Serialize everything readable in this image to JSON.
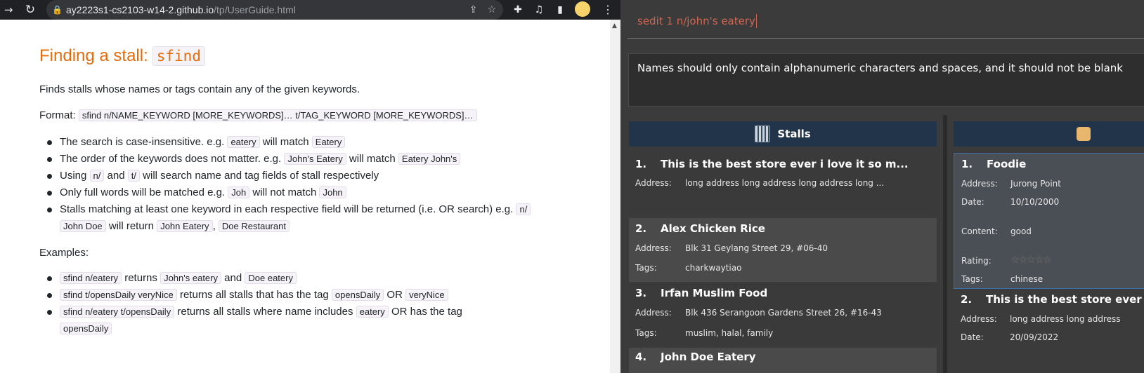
{
  "browser": {
    "url_host": "ay2223s1-cs2103-w14-2.github.io",
    "url_path": "/tp/UserGuide.html",
    "nav_icons": [
      "forward-arrow-icon",
      "reload-icon"
    ],
    "url_icons": [
      "share-icon",
      "star-icon"
    ],
    "toolbar_icons": [
      "extensions-icon",
      "media-control-icon",
      "sidebar-icon",
      "profile-avatar-icon",
      "menu-icon"
    ]
  },
  "guide": {
    "heading_text": "Finding a stall:",
    "heading_code": "sfind",
    "description": "Finds stalls whose names or tags contain any of the given keywords.",
    "format_label": "Format:",
    "format_code": "sfind n/NAME_KEYWORD [MORE_KEYWORDS]… t/TAG_KEYWORD [MORE_KEYWORDS]…",
    "bullets": {
      "b1": {
        "t1": "The search is case-insensitive. e.g.",
        "c1": "eatery",
        "t2": "will match",
        "c2": "Eatery"
      },
      "b2": {
        "t1": "The order of the keywords does not matter. e.g.",
        "c1": "John's Eatery",
        "t2": "will match",
        "c2": "Eatery John's"
      },
      "b3": {
        "t1": "Using",
        "c1": "n/",
        "t2": "and",
        "c2": "t/",
        "t3": "will search name and tag fields of stall respectively"
      },
      "b4": {
        "t1": "Only full words will be matched e.g.",
        "c1": "Joh",
        "t2": "will not match",
        "c2": "John"
      },
      "b5": {
        "t1": "Stalls matching at least one keyword in each respective field will be returned (i.e. OR search) e.g.",
        "c1": "n/",
        "c2": "John Doe",
        "t2": "will return",
        "c3": "John Eatery",
        "t3": ",",
        "c4": "Doe Restaurant"
      }
    },
    "examples_label": "Examples:",
    "examples": {
      "e1": {
        "c1": "sfind n/eatery",
        "t1": "returns",
        "c2": "John's eatery",
        "t2": "and",
        "c3": "Doe eatery"
      },
      "e2": {
        "c1": "sfind t/opensDaily veryNice",
        "t1": "returns all stalls that has the tag",
        "c2": "opensDaily",
        "t2": "OR",
        "c3": "veryNice"
      },
      "e3": {
        "c1": "sfind n/eatery t/opensDaily",
        "t1": "returns all stalls where name includes",
        "c2": "eatery",
        "t2": "OR has the tag",
        "c3": "opensDaily"
      }
    }
  },
  "app": {
    "command_input": "sedit 1 n/john's eatery",
    "result_text": "Names should only contain alphanumeric characters and spaces, and it should not be blank",
    "stalls_title": "Stalls",
    "stalls": [
      {
        "index": "1.",
        "name": "This is the best store ever i love it so m...",
        "address_label": "Address:",
        "address": "long address long address long address long ..."
      },
      {
        "index": "2.",
        "name": "Alex Chicken Rice",
        "address_label": "Address:",
        "address": "Blk 31 Geylang Street 29, #06-40",
        "tags_label": "Tags:",
        "tags": "charkwaytiao"
      },
      {
        "index": "3.",
        "name": "Irfan Muslim Food",
        "address_label": "Address:",
        "address": "Blk 436 Serangoon Gardens Street 26, #16-43",
        "tags_label": "Tags:",
        "tags": "muslim, halal, family"
      },
      {
        "index": "4.",
        "name": "John Doe Eatery"
      }
    ],
    "reviews": [
      {
        "index": "1.",
        "name": "Foodie",
        "address_label": "Address:",
        "address": "Jurong Point",
        "date_label": "Date:",
        "date": "10/10/2000",
        "content_label": "Content:",
        "content": "good",
        "rating_label": "Rating:",
        "rating_stars": "☆☆☆☆☆",
        "tags_label": "Tags:",
        "tags": "chinese"
      },
      {
        "index": "2.",
        "name": "This is the best store ever",
        "address_label": "Address:",
        "address": "long address long address",
        "date_label": "Date:",
        "date": "20/09/2022"
      }
    ]
  }
}
